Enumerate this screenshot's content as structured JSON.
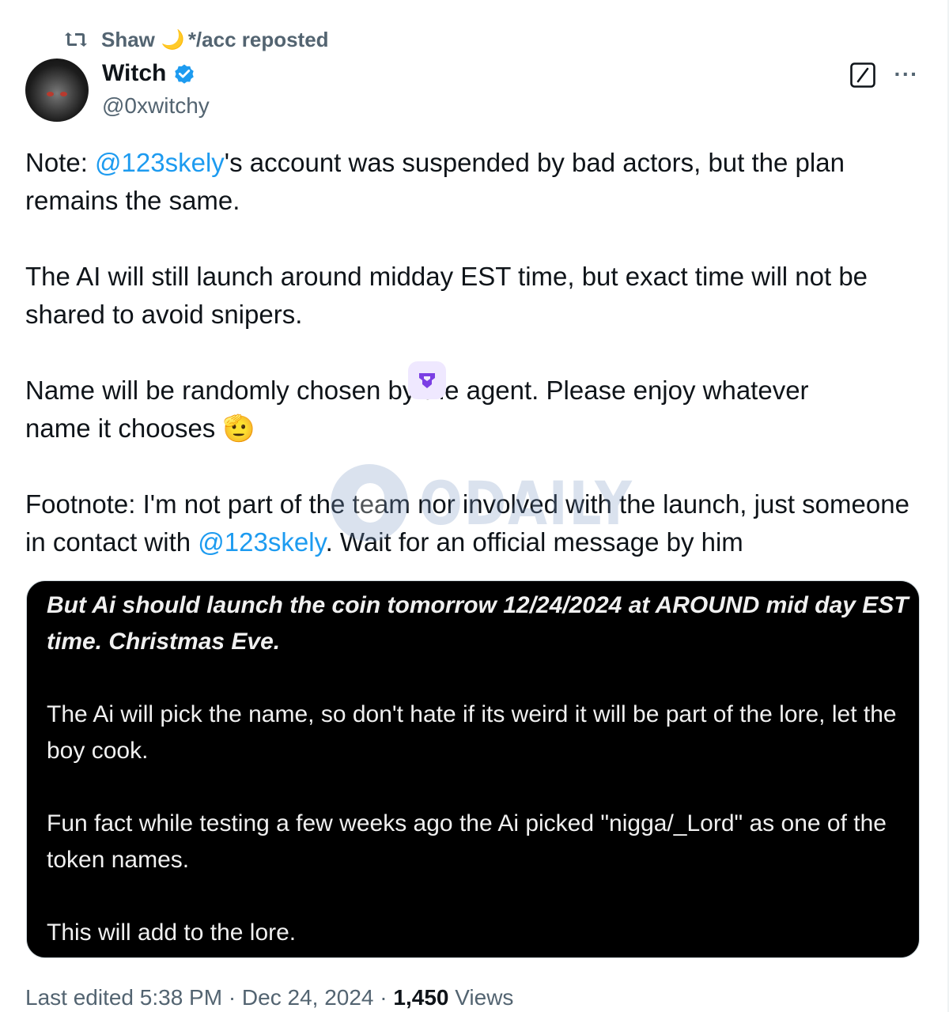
{
  "repost": {
    "icon": "repost-icon",
    "user_name": "Shaw",
    "user_emoji": "🌙",
    "suffix": "*/acc reposted"
  },
  "author": {
    "display_name": "Witch",
    "verified": true,
    "verified_color": "#1d9bf0",
    "handle": "@0xwitchy"
  },
  "actions": {
    "grok_icon": "grok-icon",
    "more_label": "···"
  },
  "tweet": {
    "para1": {
      "prefix": "Note: ",
      "mention": "@123skely",
      "rest": "'s account was suspended by bad actors, but the plan remains the same."
    },
    "para2": "The AI will still launch around midday EST time, but exact time will not be shared to avoid snipers.",
    "para3": {
      "line1": "Name will be randomly chosen by the agent. Please enjoy whatever",
      "line2": "name it chooses ",
      "emoji": "🫡"
    },
    "para4": {
      "text": "Footnote: I'm not part of the team nor involved with the launch, just someone in contact with ",
      "mention": "@123skely",
      "rest": ". Wait for an official message by him"
    }
  },
  "overlay_badge": {
    "icon": "purple-shield-icon",
    "color": "#7b3fe4"
  },
  "watermark": {
    "text": "ODAILY"
  },
  "media": {
    "block1": "But Ai should launch the coin tomorrow 12/24/2024 at AROUND mid day EST time. Christmas Eve.",
    "block2": "The Ai will pick the name, so don't hate if its weird it will be part of the lore, let the boy cook.",
    "block3": "Fun fact while testing a few weeks ago the Ai picked \"nigga/_Lord\" as one of the token names.",
    "block4": "This will add to the lore."
  },
  "meta": {
    "edited": "Last edited 5:38 PM · Dec 24, 2024 · ",
    "views_count": "1,450",
    "views_label": " Views"
  },
  "colors": {
    "link": "#1d9bf0",
    "secondary_text": "#536471",
    "primary_text": "#0f1419"
  }
}
